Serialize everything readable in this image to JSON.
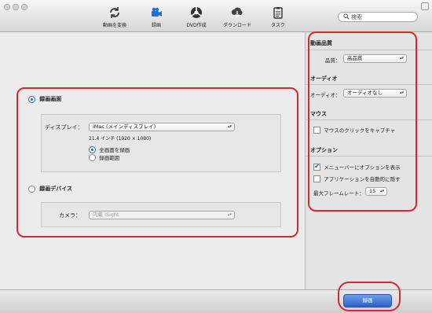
{
  "toolbar": {
    "items": [
      {
        "label": "動画を変換",
        "icon": "convert-icon"
      },
      {
        "label": "録画",
        "icon": "record-icon"
      },
      {
        "label": "DVD作成",
        "icon": "dvd-icon"
      },
      {
        "label": "ダウンロード",
        "icon": "download-icon"
      },
      {
        "label": "タスク",
        "icon": "task-icon"
      }
    ],
    "active": "録画",
    "search_placeholder": "検索"
  },
  "main": {
    "screen_section": {
      "label": "録画画面",
      "selected": true,
      "display_label": "ディスプレイ：",
      "display_value": "iMac (メインディスプレイ)",
      "display_info": "21.4 インチ (1920 × 1080)",
      "options": [
        {
          "label": "全画面を録画",
          "selected": true
        },
        {
          "label": "録画範囲",
          "selected": false
        }
      ]
    },
    "device_section": {
      "label": "録画デバイス",
      "selected": false,
      "camera_label": "カメラ：",
      "camera_value": "内蔵 iSight"
    }
  },
  "sidebar": {
    "quality": {
      "title": "動画品質",
      "label": "品質：",
      "value": "高品質"
    },
    "audio": {
      "title": "オーディオ",
      "label": "オーディオ：",
      "value": "オーディオなし"
    },
    "mouse": {
      "title": "マウス",
      "capture_label": "マウスのクリックをキャプチャ",
      "capture_checked": false
    },
    "options": {
      "title": "オプション",
      "menubar_label": "メニューバーにオプションを表示",
      "menubar_checked": true,
      "autohide_label": "アプリケーションを自動的に隠す",
      "autohide_checked": false,
      "framerate_label": "最大フレームレート：",
      "framerate_value": "15"
    }
  },
  "bottom": {
    "record_button": "録画"
  },
  "colors": {
    "highlight": "#d8282f",
    "accent": "#2b61c6"
  }
}
